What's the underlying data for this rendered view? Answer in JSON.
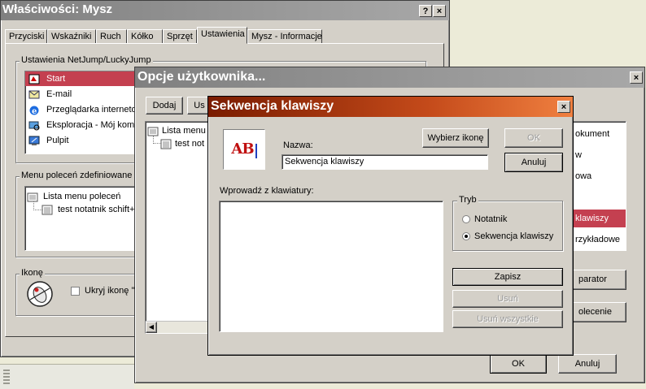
{
  "mysz": {
    "title": "Właściwości: Mysz",
    "help_btn": "?",
    "close_btn": "×",
    "tabs": [
      "Przyciski",
      "Wskaźniki",
      "Ruch",
      "Kółko",
      "Sprzęt",
      "Ustawienia",
      "Mysz - Informacje"
    ],
    "group_netjump": "Ustawienia NetJump/LuckyJump",
    "list_items": [
      "Start",
      "E-mail",
      "Przeglądarka internetowa",
      "Eksploracja - Mój komputer",
      "Pulpit"
    ],
    "group_menu": "Menu poleceń zdefiniowane p",
    "tree_root": "Lista menu poleceń",
    "tree_child": "test notatnik schift+F",
    "group_icon": "Ikonę",
    "hide_icon_label": "Ukryj ikonę \""
  },
  "opcje": {
    "title": "Opcje użytkownika...",
    "close_btn": "×",
    "btn_add": "Dodaj",
    "btn_us": "Us",
    "tree_root": "Lista menu",
    "tree_child": "test not",
    "right_items": [
      "okument",
      "w",
      "owa",
      "",
      "klawiszy",
      "rzykładowe"
    ],
    "btn_separator": "parator",
    "btn_command": "olecenie",
    "btn_ok": "OK",
    "btn_cancel": "Anuluj"
  },
  "sek": {
    "title": "Sekwencja klawiszy",
    "close_btn": "×",
    "icon_text": "AB",
    "btn_choose_icon": "Wybierz ikonę",
    "btn_ok": "OK",
    "btn_cancel": "Anuluj",
    "name_label": "Nazwa:",
    "name_value": "Sekwencja klawiszy",
    "enter_label": "Wprowadź z klawiatury:",
    "mode_label": "Tryb",
    "mode_notepad": "Notatnik",
    "mode_sequence": "Sekwencja klawiszy",
    "btn_save": "Zapisz",
    "btn_delete": "Usuń",
    "btn_delete_all": "Usuń wszystkie"
  }
}
